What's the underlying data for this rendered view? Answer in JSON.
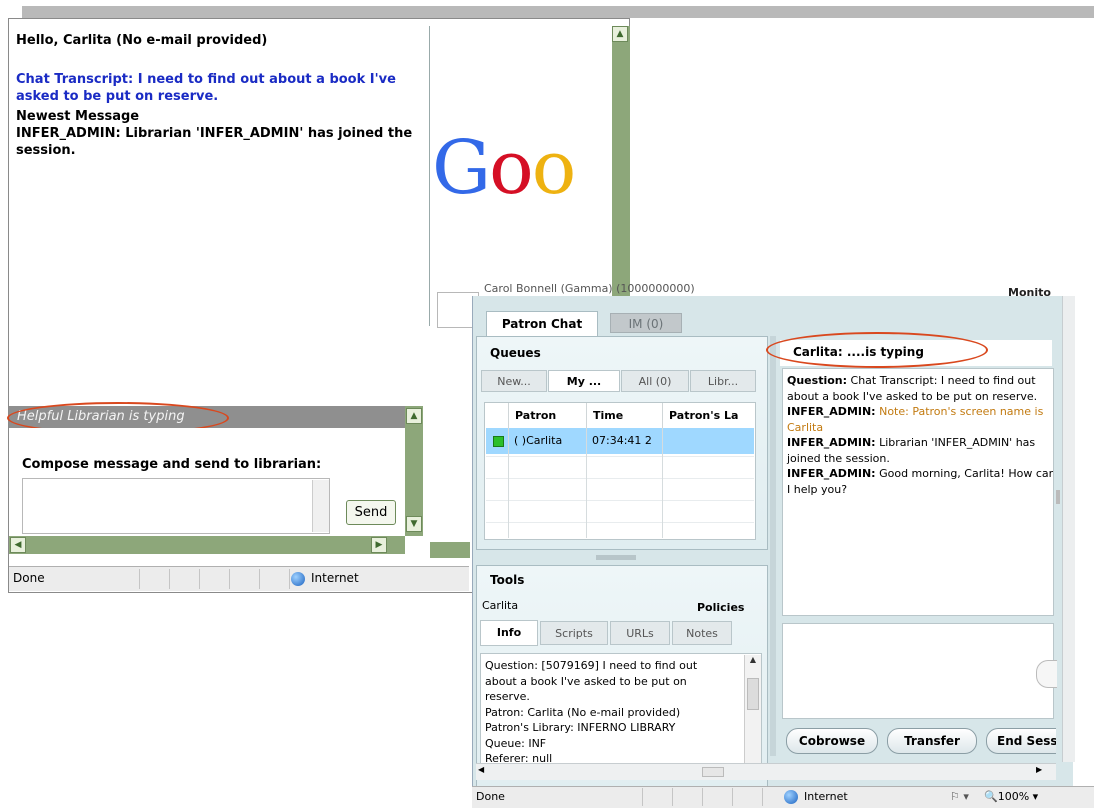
{
  "patron_window": {
    "greeting": "Hello, Carlita (No e-mail provided)",
    "chat_transcript": "Chat Transcript: I need to find out about a book I've asked to be put on reserve.",
    "newest_message_label": "Newest Message",
    "newest_message_text": "INFER_ADMIN: Librarian 'INFER_ADMIN' has joined the session.",
    "google_logo_text": "Goo",
    "typing_status": "Helpful Librarian is typing",
    "compose_label": "Compose message and send to librarian:",
    "compose_value": "",
    "send_label": "Send",
    "status_text": "Done",
    "zone_text": "Internet"
  },
  "librarian_window": {
    "header_left": "Carol Bonnell (Gamma) (1000000000)",
    "header_right": "Monito",
    "tabs": [
      {
        "label": "Patron Chat"
      },
      {
        "label": "IM (0)"
      }
    ],
    "queues": {
      "title": "Queues",
      "tabs": [
        {
          "label": "New..."
        },
        {
          "label": "My ..."
        },
        {
          "label": "All (0)"
        },
        {
          "label": "Libr..."
        }
      ],
      "columns": [
        "Patron",
        "Time",
        "Patron's La"
      ],
      "rows": [
        {
          "patron": "( )Carlita",
          "time": "07:34:41 2"
        }
      ]
    },
    "tools": {
      "title": "Tools",
      "patron_name": "Carlita",
      "policies_label": "Policies",
      "tabs": [
        {
          "label": "Info"
        },
        {
          "label": "Scripts"
        },
        {
          "label": "URLs"
        },
        {
          "label": "Notes"
        }
      ],
      "info_lines": [
        "Question: [5079169] I need to find out",
        "about a book I've asked to be put on",
        "reserve.",
        "Patron: Carlita (No e-mail provided)",
        "Patron's Library: INFERNO LIBRARY",
        "Queue: INF",
        "Referer: null"
      ]
    },
    "chat": {
      "header": "Carlita: ....is typing",
      "lines": [
        {
          "name": "Question:",
          "text": " Chat Transcript: I need to find out",
          "note": ""
        },
        {
          "name": "",
          "text": "about a book I've asked to be put on reserve.",
          "note": ""
        },
        {
          "name": "INFER_ADMIN:",
          "text": " ",
          "note": "Note: Patron's screen name is"
        },
        {
          "name": "",
          "text": "",
          "note": "Carlita"
        },
        {
          "name": "INFER_ADMIN:",
          "text": " Librarian 'INFER_ADMIN' has",
          "note": ""
        },
        {
          "name": "",
          "text": "joined the session.",
          "note": ""
        },
        {
          "name": "INFER_ADMIN:",
          "text": " Good morning, Carlita! How can",
          "note": ""
        },
        {
          "name": "",
          "text": "I help you?",
          "note": ""
        }
      ],
      "message_value": ""
    },
    "buttons": {
      "cobrowse": "Cobrowse",
      "transfer": "Transfer",
      "end_session": "End Session"
    },
    "status_text": "Done",
    "zone_text": "Internet",
    "zoom_text": "100%"
  },
  "colors": {
    "scrollbar_green": "#8da77a",
    "transcript_blue": "#1a2bc4",
    "annotation_red": "#d9481e",
    "selected_row": "#9fd8ff",
    "panel_bg": "#d7e6e9"
  }
}
